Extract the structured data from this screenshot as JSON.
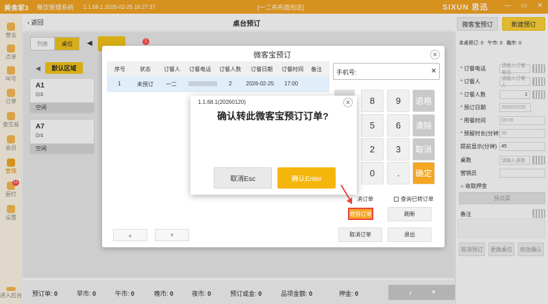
{
  "titlebar": {
    "logo": "美食家3",
    "app_name": "餐饮管理系统",
    "version_time": "1.1.68.1  2026-02-25 16:27:37",
    "store": "[一二布布面包店]",
    "brand": "SIXUN 思迅",
    "min": "—",
    "max": "▭",
    "close": "✕"
  },
  "sidebar": {
    "items": [
      {
        "label": "营业"
      },
      {
        "label": "点单"
      },
      {
        "label": "叫号"
      },
      {
        "label": "订单"
      },
      {
        "label": "查交易"
      },
      {
        "label": "会员"
      },
      {
        "label": "管理"
      },
      {
        "label": "厨打",
        "badge": "11"
      },
      {
        "label": "设置"
      }
    ],
    "bottom": "进入后台"
  },
  "header": {
    "back": "返回",
    "title": "桌台预订",
    "btn_wcy": "微客宝预订",
    "btn_new": "新建预订"
  },
  "main": {
    "toggle_list": "列表",
    "toggle_table": "桌位",
    "tab_badge": "1",
    "zone": "默认区域",
    "tables": [
      {
        "name": "A1",
        "count": "0/4",
        "status": "空闲"
      },
      {
        "name": "A7",
        "count": "0/4",
        "status": "空闲"
      }
    ]
  },
  "footer": {
    "items": [
      {
        "label": "预订单:",
        "value": "0"
      },
      {
        "label": "早市:",
        "value": "0"
      },
      {
        "label": "午市:",
        "value": "0"
      },
      {
        "label": "晚市:",
        "value": "0"
      },
      {
        "label": "夜市:",
        "value": "0"
      },
      {
        "label": "预订或金:",
        "value": "0"
      },
      {
        "label": "品项金额:",
        "value": "0"
      },
      {
        "label": "押金:",
        "value": "0"
      }
    ],
    "up": "▲",
    "down": "▼"
  },
  "right_panel": {
    "summary": [
      {
        "label": "本桌预订:",
        "value": "0"
      },
      {
        "label": "午市:",
        "value": "0"
      },
      {
        "label": "晚市:",
        "value": "0"
      }
    ],
    "fields": {
      "phone": {
        "label": "订餐电话",
        "placeholder": "请输入订餐电话"
      },
      "person": {
        "label": "订餐人",
        "placeholder": "请输入订餐人"
      },
      "count": {
        "label": "订餐人数",
        "value": "1"
      },
      "date": {
        "label": "预订日期",
        "value": "2026/02/25"
      },
      "meal_time": {
        "label": "用餐时间",
        "value": "09:00"
      },
      "duration": {
        "label": "预留时长(分钟)",
        "value": "30"
      },
      "remind": {
        "label": "提前显示(分钟)",
        "value": "45"
      },
      "tables": {
        "label": "桌数",
        "placeholder": "请输入桌数"
      },
      "staff": {
        "label": "营销员"
      }
    },
    "deposit": "收取押金",
    "pre_dish": "预点菜",
    "remark": "备注",
    "btn_cancel": "取消预订",
    "btn_change": "更换桌位",
    "btn_modify": "修改确认"
  },
  "dialog": {
    "title": "微客宝预订",
    "close": "✕",
    "columns": [
      "序号",
      "状态",
      "订餐人",
      "订餐电话",
      "订餐人数",
      "订餐日期",
      "订餐时间",
      "备注"
    ],
    "rows": [
      {
        "no": "1",
        "status": "未预订",
        "person": "一二",
        "phone": "",
        "count": "2",
        "date": "2026-02-25",
        "time": "17:00",
        "remark": ""
      }
    ],
    "phone_placeholder": "手机号:",
    "phone_clear": "✕",
    "keys": {
      "k8": "8",
      "k9": "9",
      "back": "退格",
      "k5": "5",
      "k6": "6",
      "clear": "清除",
      "k2": "2",
      "k3": "3",
      "cancel": "取消",
      "k0": "0",
      "dot": ".",
      "ok": "确定"
    },
    "cancelled_label": "消订单",
    "query_transferred": "查询已转订单",
    "btn_transfer": "转预订单",
    "btn_refresh": "刷新",
    "btn_cancel_order": "取消订单",
    "btn_exit": "退出",
    "page_up": "▲",
    "page_down": "▼"
  },
  "confirm": {
    "version": "1.1.68.1(20260120)",
    "message": "确认转此微客宝预订订单?",
    "cancel": "取消Esc",
    "ok": "确认Enter",
    "close": "✕"
  },
  "colors": {
    "accent": "#f5a623",
    "confirm": "#f5b60b",
    "highlight_border": "#e8463a"
  }
}
